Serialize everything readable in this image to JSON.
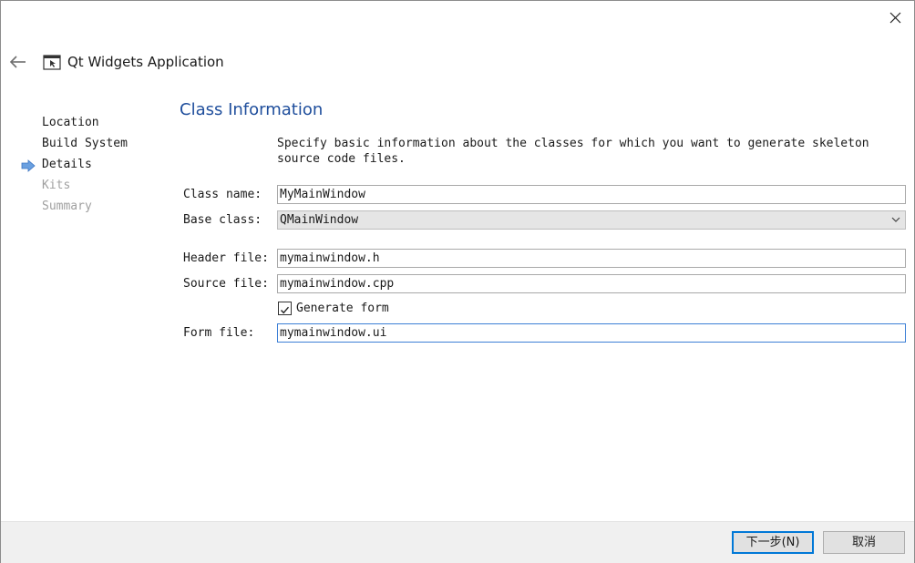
{
  "window": {
    "title": "Qt Widgets Application",
    "close_icon": "close-icon",
    "back_icon": "back-arrow-icon",
    "app_icon": "qt-application-icon"
  },
  "steps": {
    "items": [
      {
        "label": "Location",
        "state": "done"
      },
      {
        "label": "Build System",
        "state": "done"
      },
      {
        "label": "Details",
        "state": "current"
      },
      {
        "label": "Kits",
        "state": "disabled"
      },
      {
        "label": "Summary",
        "state": "disabled"
      }
    ],
    "current_marker_icon": "current-step-arrow-icon"
  },
  "page": {
    "title": "Class Information",
    "description": "Specify basic information about the classes for which you want to generate skeleton source code files."
  },
  "form": {
    "class_name_label": "Class name:",
    "class_name_value": "MyMainWindow",
    "base_class_label": "Base class:",
    "base_class_value": "QMainWindow",
    "header_file_label": "Header file:",
    "header_file_value": "mymainwindow.h",
    "source_file_label": "Source file:",
    "source_file_value": "mymainwindow.cpp",
    "generate_form_label": "Generate form",
    "generate_form_checked": true,
    "form_file_label": "Form file:",
    "form_file_value": "mymainwindow.ui"
  },
  "footer": {
    "next_label": "下一步(N)",
    "cancel_label": "取消"
  },
  "colors": {
    "title_accent": "#1f4e9c",
    "focus_border": "#3c7fd6",
    "arrow_fill": "#6aa0e0",
    "default_button_border": "#0078d7"
  }
}
